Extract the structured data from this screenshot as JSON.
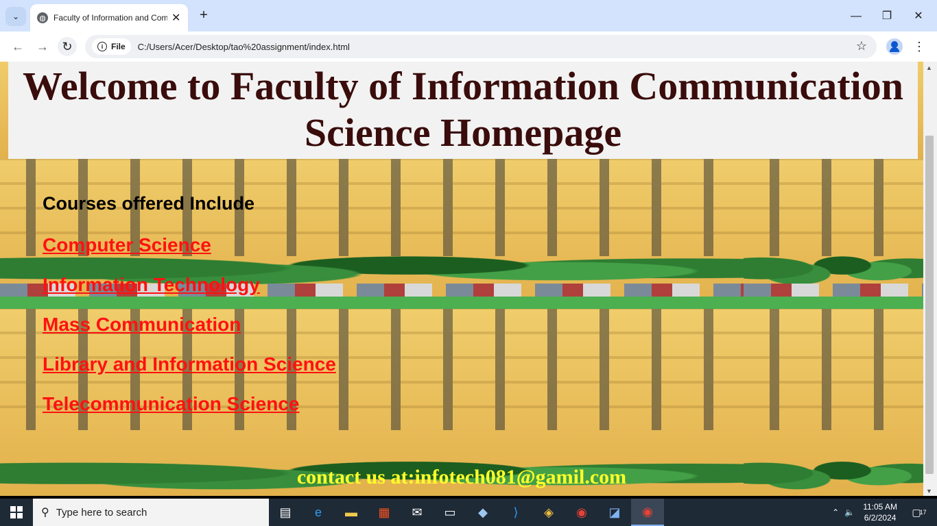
{
  "browser": {
    "tab_title": "Faculty of Information and Com",
    "favicon": "globe-icon",
    "close_glyph": "✕",
    "new_tab_glyph": "+",
    "menu_glyph": "⌄",
    "file_chip": "File",
    "url": "C:/Users/Acer/Desktop/tao%20assignment/index.html"
  },
  "page": {
    "heading": "Welcome to Faculty of Information Communication Science Homepage",
    "courses_heading": "Courses offered Include",
    "courses": [
      "Computer Science",
      "Information Technology",
      "Mass Communication",
      "Library and Information Science",
      "Telecommunication Science"
    ],
    "contact": "contact us at:infotech081@gamil.com",
    "heading_color": "#3a0c0c",
    "link_color": "#ff1111",
    "contact_color": "#ffff2a"
  },
  "taskbar": {
    "search_placeholder": "Type here to search",
    "time": "11:05 AM",
    "date": "6/2/2024",
    "notification_count": "17"
  }
}
